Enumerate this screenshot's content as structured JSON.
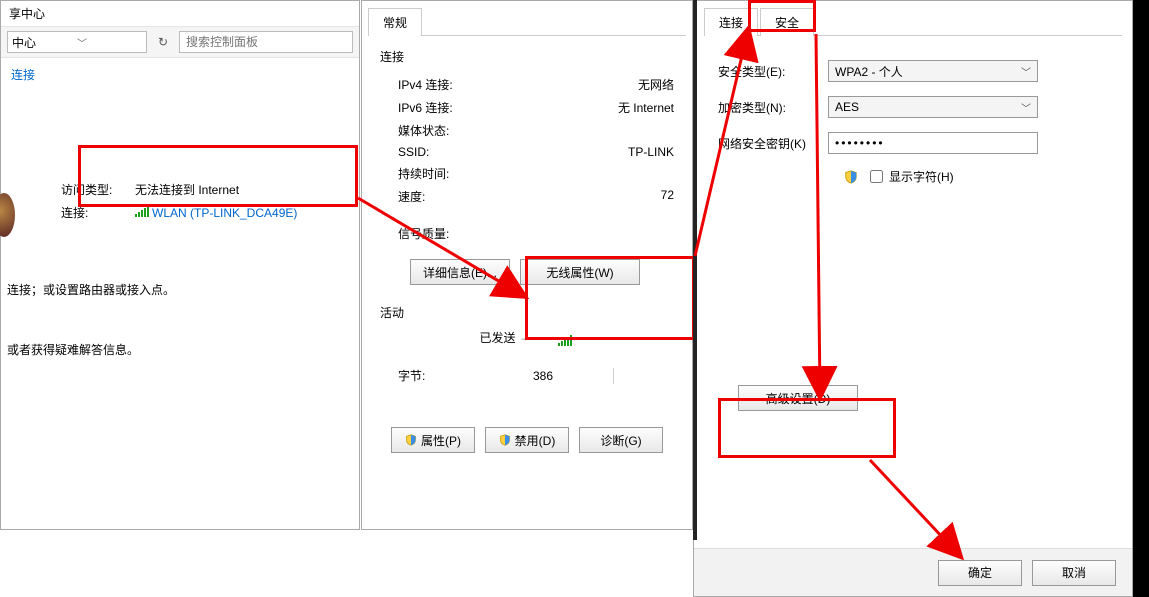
{
  "panel1": {
    "title": "享中心",
    "addressbar": "中心",
    "search_placeholder": "搜索控制面板",
    "conn_link": "连接",
    "access_label": "访问类型:",
    "access_value": "无法连接到 Internet",
    "conns_label": "连接:",
    "conns_value": "WLAN (TP-LINK_DCA49E)",
    "hint1": "连接；或设置路由器或接入点。",
    "hint2": "或者获得疑难解答信息。"
  },
  "panel2": {
    "tab_general": "常规",
    "section_connection": "连接",
    "ipv4_label": "IPv4 连接:",
    "ipv4_value": "无网络",
    "ipv6_label": "IPv6 连接:",
    "ipv6_value": "无 Internet",
    "media_label": "媒体状态:",
    "media_value": "",
    "ssid_label": "SSID:",
    "ssid_value": "TP-LINK",
    "duration_label": "持续时间:",
    "duration_value": "",
    "speed_label": "速度:",
    "speed_value": "72",
    "signal_label": "信号质量:",
    "btn_details": "详细信息(E)...",
    "btn_wireless": "无线属性(W)",
    "section_activity": "活动",
    "sent_label": "已发送",
    "bytes_label": "字节:",
    "bytes_sent": "386",
    "btn_properties": "属性(P)",
    "btn_disable": "禁用(D)",
    "btn_diagnose": "诊断(G)"
  },
  "panel3": {
    "tab_connection": "连接",
    "tab_security": "安全",
    "sec_type_label": "安全类型(E):",
    "sec_type_value": "WPA2 - 个人",
    "enc_type_label": "加密类型(N):",
    "enc_type_value": "AES",
    "key_label": "网络安全密钥(K)",
    "key_value": "••••••••",
    "show_chars_label": "显示字符(H)",
    "btn_advanced": "高级设置(D)",
    "btn_ok": "确定",
    "btn_cancel": "取消"
  }
}
